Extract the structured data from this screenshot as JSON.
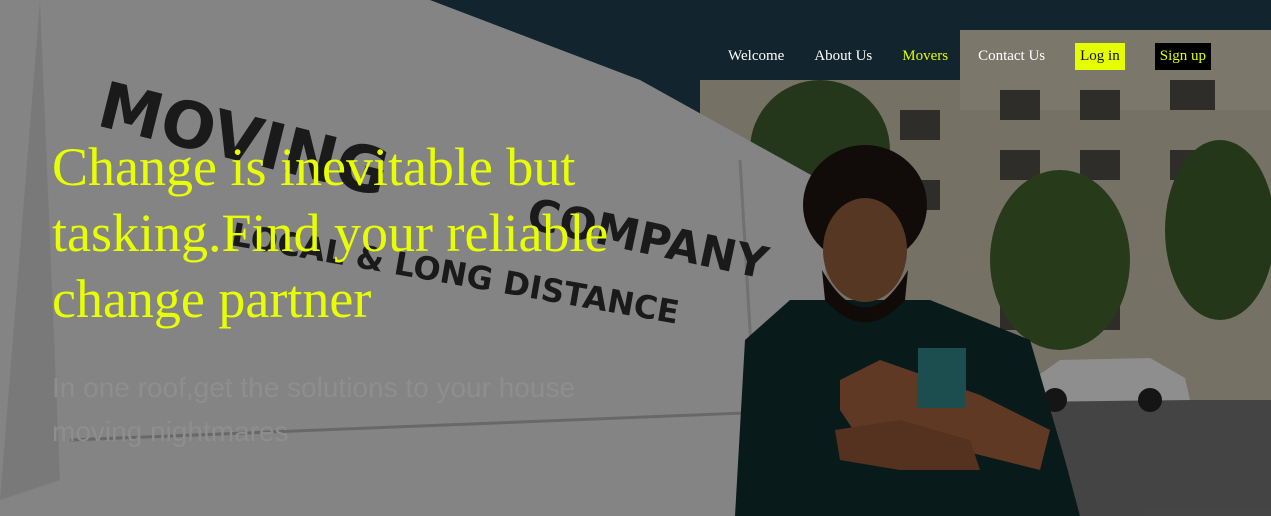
{
  "nav": {
    "items": [
      {
        "label": "Welcome",
        "active": false
      },
      {
        "label": "About Us",
        "active": false
      },
      {
        "label": "Movers",
        "active": true
      },
      {
        "label": "Contact Us",
        "active": false
      }
    ],
    "login_label": "Log in",
    "signup_label": "Sign up"
  },
  "hero": {
    "headline": "Change is inevitable but tasking.Find your reliable change partner",
    "subline": "In one roof,get the solutions to your house moving nightmares",
    "van_lettering": "MOVING COMPANY LOCAL & LONG DISTANCE"
  },
  "colors": {
    "accent": "#e8ff00",
    "nav_text": "#ffffff",
    "subtext": "#8e8e8e"
  }
}
